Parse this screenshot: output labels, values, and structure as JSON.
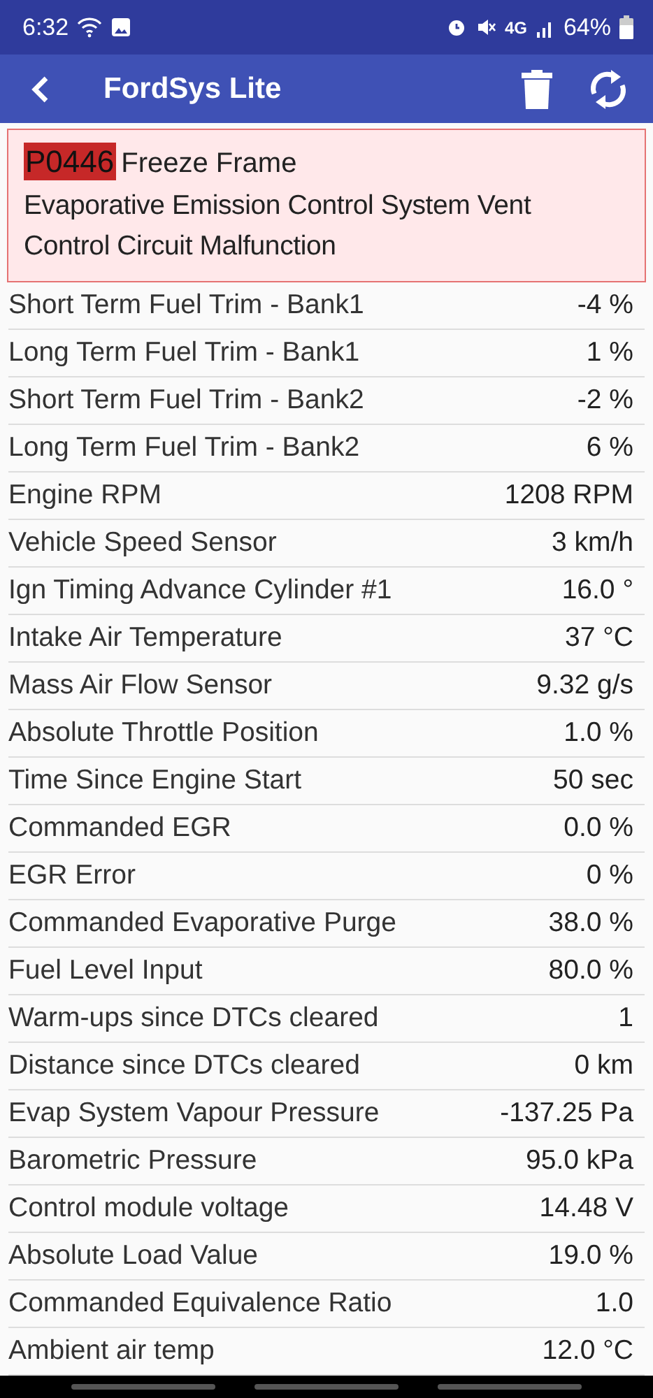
{
  "status_bar": {
    "time": "6:32",
    "network": "4G",
    "battery": "64%"
  },
  "toolbar": {
    "title": "FordSys Lite"
  },
  "dtc": {
    "code": "P0446",
    "heading": "Freeze Frame",
    "description": "Evaporative Emission Control System Vent Control Circuit Malfunction"
  },
  "rows": [
    {
      "name": "Short Term Fuel Trim - Bank1",
      "value": "-4 %"
    },
    {
      "name": "Long Term Fuel Trim - Bank1",
      "value": "1 %"
    },
    {
      "name": "Short Term Fuel Trim - Bank2",
      "value": "-2 %"
    },
    {
      "name": "Long Term Fuel Trim - Bank2",
      "value": "6 %"
    },
    {
      "name": "Engine RPM",
      "value": "1208 RPM"
    },
    {
      "name": "Vehicle Speed Sensor",
      "value": "3 km/h"
    },
    {
      "name": "Ign Timing Advance Cylinder #1",
      "value": "16.0 °"
    },
    {
      "name": "Intake Air Temperature",
      "value": "37 °C"
    },
    {
      "name": "Mass Air Flow Sensor",
      "value": "9.32 g/s"
    },
    {
      "name": "Absolute Throttle Position",
      "value": "1.0 %"
    },
    {
      "name": "Time Since Engine Start",
      "value": "50 sec"
    },
    {
      "name": "Commanded EGR",
      "value": "0.0 %"
    },
    {
      "name": "EGR Error",
      "value": "0 %"
    },
    {
      "name": "Commanded Evaporative Purge",
      "value": "38.0 %"
    },
    {
      "name": "Fuel Level Input",
      "value": "80.0 %"
    },
    {
      "name": "Warm-ups since DTCs cleared",
      "value": "1"
    },
    {
      "name": "Distance since DTCs cleared",
      "value": "0 km"
    },
    {
      "name": "Evap System Vapour Pressure",
      "value": "-137.25 Pa"
    },
    {
      "name": "Barometric Pressure",
      "value": "95.0 kPa"
    },
    {
      "name": "Control module voltage",
      "value": "14.48 V"
    },
    {
      "name": "Absolute Load Value",
      "value": "19.0 %"
    },
    {
      "name": "Commanded Equivalence Ratio",
      "value": "1.0"
    },
    {
      "name": "Ambient air temp",
      "value": "12.0 °C"
    }
  ]
}
